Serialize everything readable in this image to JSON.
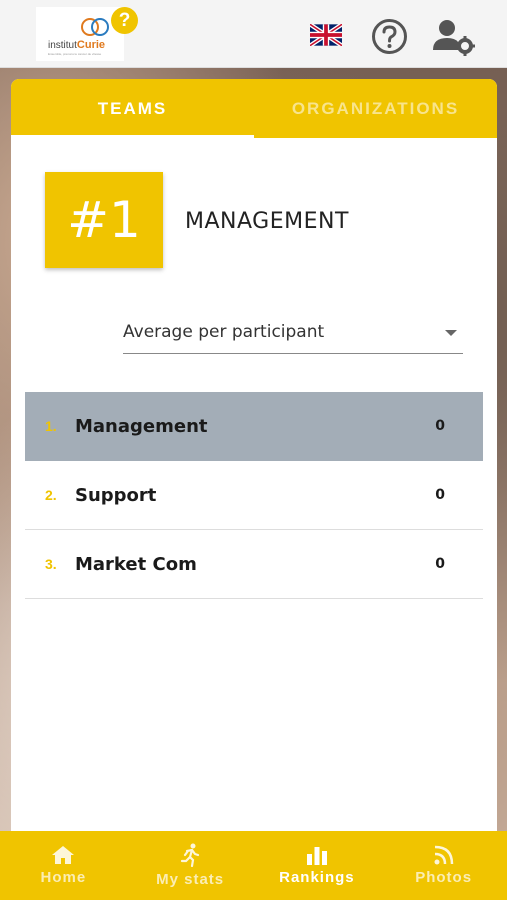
{
  "header": {
    "logo_text_prefix": "institut",
    "logo_text_brand": "Curie",
    "logo_subtitle": "Ensemble, prenons le cancer de vitesse",
    "help_badge": "?",
    "language_icon": "uk-flag-icon",
    "help_icon": "question-circle-icon",
    "settings_icon": "user-gear-icon"
  },
  "tabs": [
    {
      "label": "TEAMS",
      "active": true
    },
    {
      "label": "ORGANIZATIONS",
      "active": false
    }
  ],
  "leader": {
    "rank": "#1",
    "name": "MANAGEMENT"
  },
  "filter": {
    "selected": "Average per participant"
  },
  "rankings": [
    {
      "num": "1.",
      "name": "Management",
      "score": "0",
      "highlight": true
    },
    {
      "num": "2.",
      "name": "Support",
      "score": "0",
      "highlight": false
    },
    {
      "num": "3.",
      "name": "Market Com",
      "score": "0",
      "highlight": false
    }
  ],
  "nav": [
    {
      "label": "Home",
      "icon": "home-icon",
      "active": false
    },
    {
      "label": "My stats",
      "icon": "runner-icon",
      "active": false
    },
    {
      "label": "Rankings",
      "icon": "bar-chart-icon",
      "active": true
    },
    {
      "label": "Photos",
      "icon": "rss-icon",
      "active": false
    }
  ],
  "colors": {
    "accent": "#f0c400",
    "highlight_row": "#a3adb7"
  }
}
